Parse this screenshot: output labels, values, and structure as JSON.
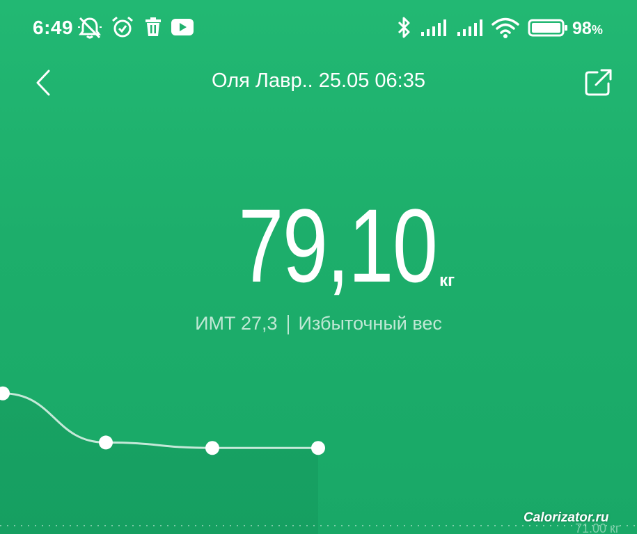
{
  "status_bar": {
    "time": "6:49",
    "battery_level": "98",
    "battery_unit": "%"
  },
  "header": {
    "title": "Оля Лавр.. 25.05 06:35"
  },
  "measurement": {
    "weight": "79,10",
    "unit": "кг",
    "bmi_text": "ИМТ 27,3",
    "category": "Избыточный вес"
  },
  "chart_data": {
    "type": "line",
    "y": [
      79.6,
      79.15,
      79.1,
      79.1
    ],
    "y_axis_visible_label": "71.00 кг"
  },
  "watermark": "Calorizator.ru",
  "colors": {
    "background": "#1fb16d",
    "text": "#ffffff"
  }
}
